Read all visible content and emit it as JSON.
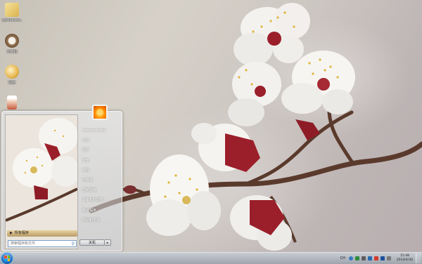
{
  "desktop": {
    "icons": [
      {
        "name": "user-folder",
        "label": "Administra..."
      },
      {
        "name": "coffee",
        "label": "计算机"
      },
      {
        "name": "network",
        "label": "网络"
      },
      {
        "name": "drink",
        "label": ""
      }
    ]
  },
  "start_menu": {
    "all_programs": "所有程序",
    "search_placeholder": "搜索程序和文件",
    "user_name": "Administrator",
    "right_items": [
      "文档",
      "图片",
      "音乐",
      "游戏",
      "计算机",
      "控制面板",
      "设备和打印机",
      "默认程序",
      "帮助和支持"
    ],
    "shutdown_label": "关机"
  },
  "taskbar": {
    "language": "CH",
    "time": "15:48",
    "date": "2014/4/30",
    "tray_icons": [
      "help-icon",
      "shield-icon",
      "volume-icon",
      "network-icon",
      "flag-icon",
      "security-icon",
      "arrow-icon"
    ]
  },
  "colors": {
    "taskbar": "#a8aeb7",
    "start_orb": "#1f6fc6",
    "all_programs": "#c9ab72"
  }
}
